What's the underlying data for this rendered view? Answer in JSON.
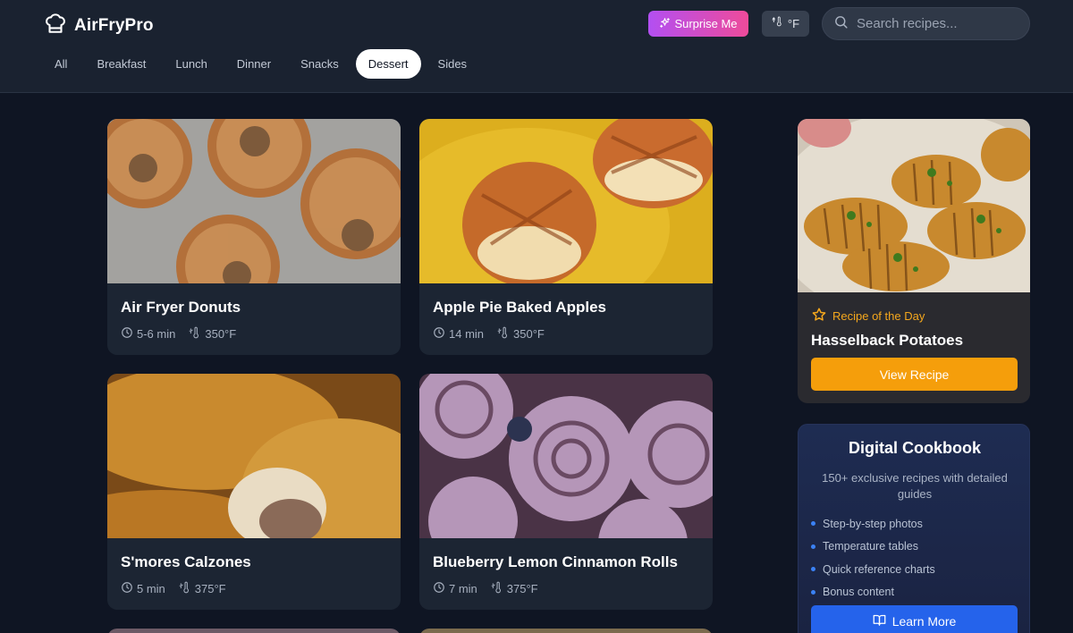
{
  "app": {
    "name": "AirFryPro"
  },
  "header": {
    "surprise_label": "Surprise Me",
    "unit_label": "°F",
    "search_placeholder": "Search recipes..."
  },
  "tabs": [
    {
      "label": "All",
      "active": false
    },
    {
      "label": "Breakfast",
      "active": false
    },
    {
      "label": "Lunch",
      "active": false
    },
    {
      "label": "Dinner",
      "active": false
    },
    {
      "label": "Snacks",
      "active": false
    },
    {
      "label": "Dessert",
      "active": true
    },
    {
      "label": "Sides",
      "active": false
    }
  ],
  "recipes": [
    {
      "title": "Air Fryer Donuts",
      "time": "5-6 min",
      "temp": "350°F",
      "photo": "cinnamon-sugar-donuts"
    },
    {
      "title": "Apple Pie Baked Apples",
      "time": "14 min",
      "temp": "350°F",
      "photo": "lattice-baked-apples"
    },
    {
      "title": "S'mores Calzones",
      "time": "5 min",
      "temp": "375°F",
      "photo": "golden-calzones"
    },
    {
      "title": "Blueberry Lemon Cinnamon Rolls",
      "time": "7 min",
      "temp": "375°F",
      "photo": "blueberry-cinnamon-rolls"
    }
  ],
  "recipe_of_day": {
    "label": "Recipe of the Day",
    "name": "Hasselback Potatoes",
    "button": "View Recipe",
    "photo": "hasselback-potatoes"
  },
  "cookbook": {
    "title": "Digital Cookbook",
    "description": "150+ exclusive recipes with detailed guides",
    "features": [
      "Step-by-step photos",
      "Temperature tables",
      "Quick reference charts",
      "Bonus content"
    ],
    "button": "Learn More"
  },
  "colors": {
    "background": "#0f1523",
    "header": "#1a2230",
    "card": "#1c2533",
    "accent_orange": "#f59e0b",
    "accent_blue": "#2563eb",
    "surprise_gradient_start": "#b34ff2",
    "surprise_gradient_end": "#ee4b9a"
  },
  "icons": {
    "logo": "chef-hat-icon",
    "surprise": "sparkles-icon",
    "unit": "thermometer-sun-icon",
    "search": "search-icon",
    "time": "clock-icon",
    "temp": "thermometer-icon",
    "rotd": "star-icon",
    "cookbook": "book-open-icon"
  }
}
